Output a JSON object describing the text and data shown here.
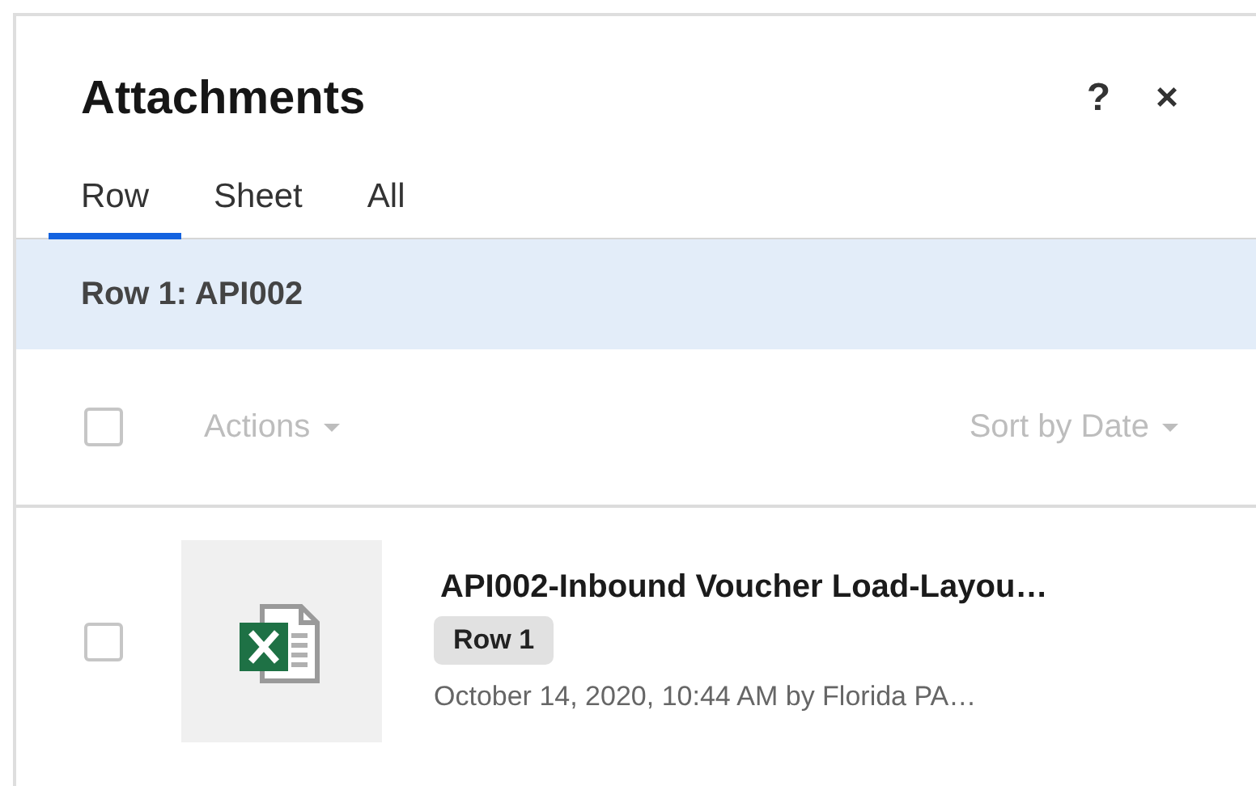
{
  "panel": {
    "title": "Attachments",
    "help": "?",
    "close": "×"
  },
  "tabs": [
    {
      "label": "Row",
      "selected": true
    },
    {
      "label": "Sheet",
      "selected": false
    },
    {
      "label": "All",
      "selected": false
    }
  ],
  "section_header": "Row 1: API002",
  "toolbar": {
    "select_all_checked": false,
    "actions": "Actions",
    "sort": "Sort by Date",
    "disabled": true
  },
  "attachments": [
    {
      "name": "API002-Inbound Voucher Load-Layou…",
      "tag": "Row 1",
      "meta": "October 14, 2020, 10:44 AM by Florida PA…",
      "checked": false,
      "kind": "spreadsheet"
    }
  ]
}
